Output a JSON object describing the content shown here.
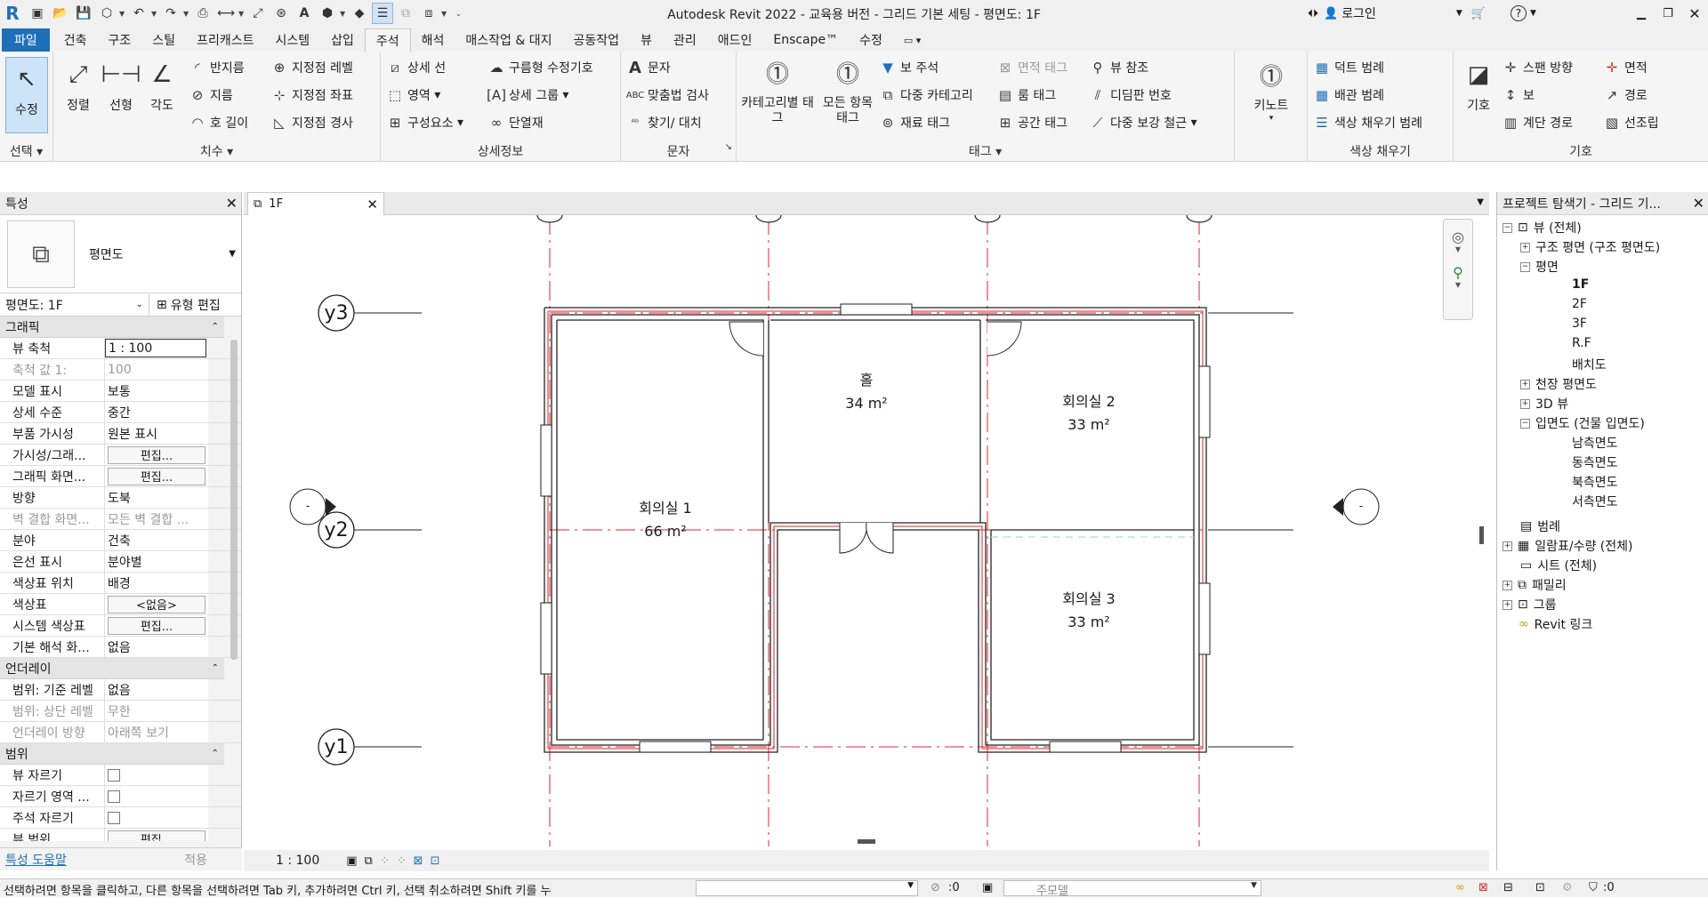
{
  "titlebar": {
    "title": "Autodesk Revit 2022 - 교육용 버전 - 그리드 기본 세팅 - 평면도: 1F",
    "login": "로그인",
    "logo": "R"
  },
  "tabs": [
    "파일",
    "건축",
    "구조",
    "스틸",
    "프리캐스트",
    "시스템",
    "삽입",
    "주석",
    "해석",
    "매스작업 & 대지",
    "공동작업",
    "뷰",
    "관리",
    "애드인",
    "Enscape™",
    "수정"
  ],
  "ribbon": {
    "select": {
      "modify": "수정",
      "title": "선택"
    },
    "dimension": {
      "aligned": "정렬",
      "linear": "선형",
      "angular": "각도",
      "radial": "반지름",
      "diameter": "지름",
      "arc_length": "호 길이",
      "spot_elev": "지정점 레벨",
      "spot_coord": "지정점 좌표",
      "spot_slope": "지정점 경사",
      "title": "치수"
    },
    "detail": {
      "detail_line": "상세 선",
      "region": "영역",
      "component": "구성요소",
      "revision_cloud": "구름형 수정기호",
      "detail_group": "상세 그룹",
      "insulation": "단열재",
      "title": "상세정보"
    },
    "text": {
      "text": "문자",
      "spell": "맞춤법 검사",
      "find_replace": "찾기/ 대치",
      "title": "문자"
    },
    "tag": {
      "by_category": "카테고리별 태그",
      "all": "모든 항목 태그",
      "beam_ann": "보 주석",
      "multi_cat": "다중 카테고리",
      "material": "재료 태그",
      "area_tag": "면적 태그",
      "room_tag": "룸 태그",
      "space_tag": "공간 태그",
      "view_ref": "뷰 참조",
      "tread_num": "디딤판 번호",
      "multi_rebar": "다중 보강 철근",
      "title": "태그"
    },
    "keynote": {
      "keynote": "키노트"
    },
    "color_fill": {
      "duct": "덕트 범례",
      "pipe": "배관 범례",
      "color_fill": "색상 채우기 범례",
      "title": "색상 채우기"
    },
    "symbol": {
      "symbol": "기호",
      "span_dir": "스팬 방향",
      "beam": "보",
      "stair_path": "계단 경로",
      "area": "면적",
      "path": "경로",
      "contour": "선조립",
      "title": "기호"
    }
  },
  "properties": {
    "title": "특성",
    "type_name": "평면도",
    "selector": "평면도: 1F",
    "edit_type": "유형 편집",
    "sections": {
      "graphics": "그래픽",
      "underlay": "언더레이",
      "extents": "범위"
    },
    "graphics": [
      {
        "k": "뷰 축척",
        "v": "1 : 100"
      },
      {
        "k": "축척 값    1:",
        "v": "100"
      },
      {
        "k": "모델 표시",
        "v": "보통"
      },
      {
        "k": "상세 수준",
        "v": "중간"
      },
      {
        "k": "부품 가시성",
        "v": "원본 표시"
      },
      {
        "k": "가시성/그래...",
        "v": "편집..."
      },
      {
        "k": "그래픽 화면...",
        "v": "편집..."
      },
      {
        "k": "방향",
        "v": "도북"
      },
      {
        "k": "벽 결합 화면...",
        "v": "모든 벽 결합 ..."
      },
      {
        "k": "분야",
        "v": "건축"
      },
      {
        "k": "은선 표시",
        "v": "분야별"
      },
      {
        "k": "색상표 위치",
        "v": "배경"
      },
      {
        "k": "색상표",
        "v": "<없음>"
      },
      {
        "k": "시스템 색상표",
        "v": "편집..."
      },
      {
        "k": "기본 해석 화...",
        "v": "없음"
      }
    ],
    "underlay": [
      {
        "k": "범위: 기준 레벨",
        "v": "없음"
      },
      {
        "k": "범위: 상단 레벨",
        "v": "무한"
      },
      {
        "k": "언더레이 방향",
        "v": "아래쪽 보기"
      }
    ],
    "extents": [
      {
        "k": "뷰 자르기",
        "v": ""
      },
      {
        "k": "자르기 영역 ...",
        "v": ""
      },
      {
        "k": "주석 자르기",
        "v": ""
      },
      {
        "k": "뷰 범위",
        "v": "편집..."
      }
    ],
    "help": "특성 도움말",
    "apply": "적용"
  },
  "view": {
    "tab": "1F",
    "scale": "1 : 100",
    "grids": {
      "y1": "y1",
      "y2": "y2",
      "y3": "y3"
    },
    "elevation_marker": "-",
    "rooms": [
      {
        "name": "홀",
        "area": "34 m²"
      },
      {
        "name": "회의실 1",
        "area": "66 m²"
      },
      {
        "name": "회의실 2",
        "area": "33 m²"
      },
      {
        "name": "회의실 3",
        "area": "33 m²"
      }
    ]
  },
  "browser": {
    "title": "프로젝트 탐색기 - 그리드 기...",
    "items": [
      "뷰 (전체)",
      "구조 평면 (구조 평면도)",
      "평면",
      "1F",
      "2F",
      "3F",
      "R.F",
      "배치도",
      "천장 평면도",
      "3D 뷰",
      "입면도 (건물 입면도)",
      "남측면도",
      "동측면도",
      "북측면도",
      "서측면도",
      "범례",
      "일람표/수량 (전체)",
      "시트 (전체)",
      "패밀리",
      "그룹",
      "Revit 링크"
    ]
  },
  "status": {
    "message": "선택하려면 항목을 클릭하고, 다른 항목을 선택하려면 Tab 키, 추가하려면 Ctrl 키, 선택 취소하려면 Shift 키를 누",
    "model": "주모델",
    "zero": ":0"
  },
  "colors": {
    "accent": "#1f6fb8",
    "grid": "#e0242a",
    "wall": "#222222"
  }
}
